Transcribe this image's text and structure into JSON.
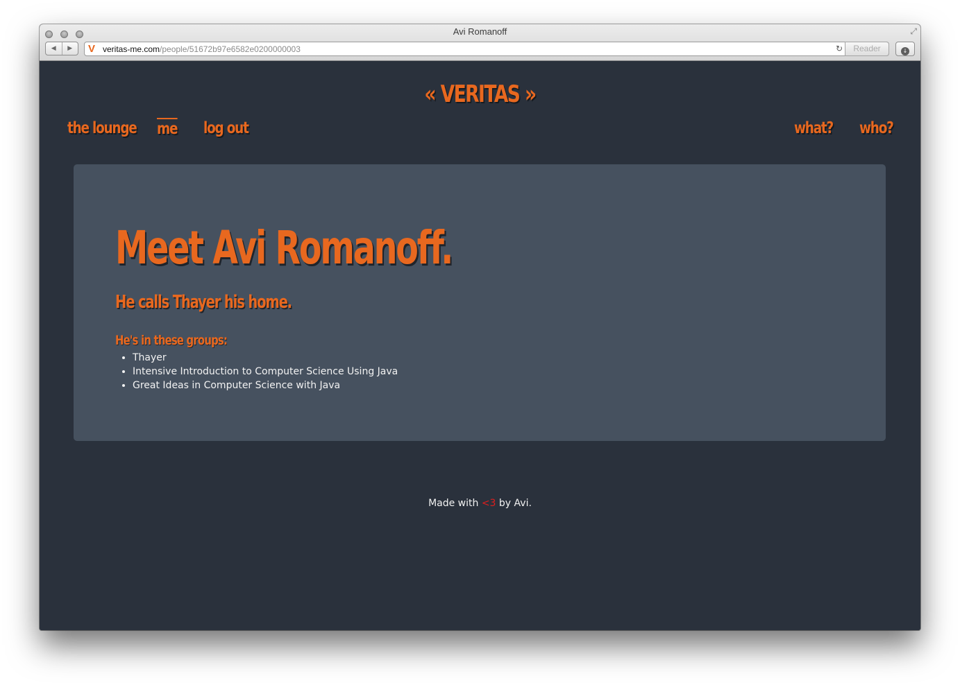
{
  "window": {
    "title": "Avi Romanoff",
    "url_domain": "veritas-me.com",
    "url_path": "/people/51672b97e6582e0200000003",
    "reader_label": "Reader",
    "favicon_letter": "V"
  },
  "site": {
    "brand": "« VERITAS »",
    "nav_left": [
      "the lounge",
      "me",
      "log out"
    ],
    "nav_right": [
      "what?",
      "who?"
    ],
    "active_nav": "me"
  },
  "profile": {
    "headline": "Meet Avi Romanoff.",
    "home_line": "He calls Thayer his home.",
    "groups_title": "He's in these groups:",
    "groups": [
      "Thayer",
      "Intensive Introduction to Computer Science Using Java",
      "Great Ideas in Computer Science with Java"
    ]
  },
  "footer": {
    "prefix": "Made with",
    "heart": "<3",
    "suffix": "by Avi."
  },
  "colors": {
    "accent": "#e8681f",
    "background": "#2a313c",
    "panel": "#46515f",
    "heart": "#e01e1e"
  }
}
